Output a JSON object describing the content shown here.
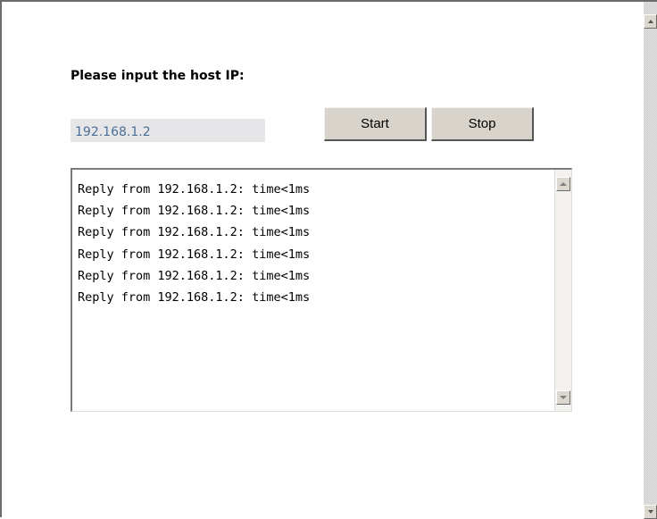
{
  "form": {
    "prompt_label": "Please input the host IP:",
    "host_ip_value": "192.168.1.2",
    "start_label": "Start",
    "stop_label": "Stop"
  },
  "log": {
    "lines": [
      "Reply from 192.168.1.2: time<1ms",
      "Reply from 192.168.1.2: time<1ms",
      "Reply from 192.168.1.2: time<1ms",
      "Reply from 192.168.1.2: time<1ms",
      "Reply from 192.168.1.2: time<1ms",
      "Reply from 192.168.1.2: time<1ms"
    ]
  },
  "icons": {
    "log_scroll_up": "scroll-up-arrow-icon",
    "log_scroll_down": "scroll-down-arrow-icon",
    "page_scroll_up": "scroll-up-arrow-icon",
    "page_scroll_down": "scroll-down-arrow-icon"
  },
  "colors": {
    "input_background": "#e6e6e8",
    "input_text": "#4a6f96",
    "button_face": "#d8d4cc"
  }
}
